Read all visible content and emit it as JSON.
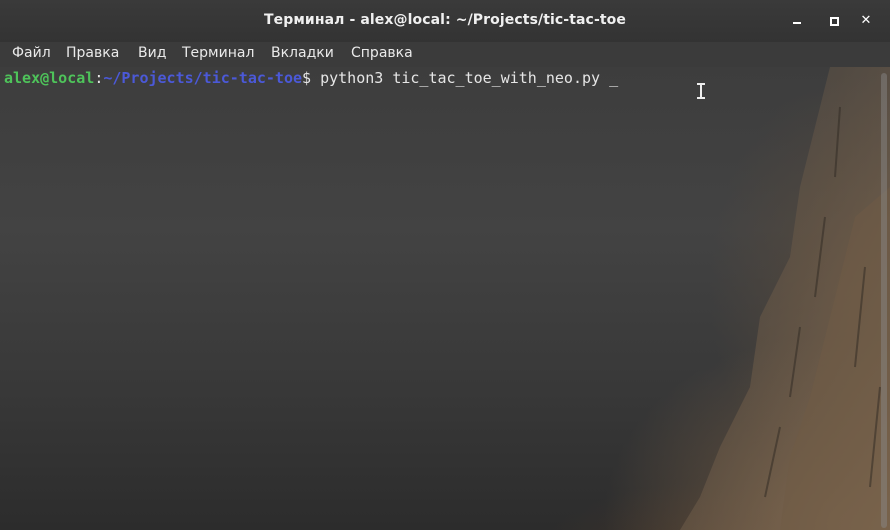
{
  "window": {
    "title": "Терминал - alex@local: ~/Projects/tic-tac-toe",
    "controls": {
      "minimize": "minimize-icon",
      "maximize": "maximize-icon",
      "close": "✕"
    }
  },
  "menu": {
    "items": [
      {
        "label": "Файл"
      },
      {
        "label": "Правка"
      },
      {
        "label": "Вид"
      },
      {
        "label": "Терминал"
      },
      {
        "label": "Вкладки"
      },
      {
        "label": "Справка"
      }
    ]
  },
  "terminal": {
    "prompt": {
      "user_host": "alex@local",
      "separator": ":",
      "path": "~/Projects/tic-tac-toe",
      "symbol": "$"
    },
    "command": " python3 tic_tac_toe_with_neo.py ",
    "cursor": "_",
    "colors": {
      "user_host": "#4ec35a",
      "path": "#4b59d8",
      "text": "#e6e6e6"
    }
  }
}
